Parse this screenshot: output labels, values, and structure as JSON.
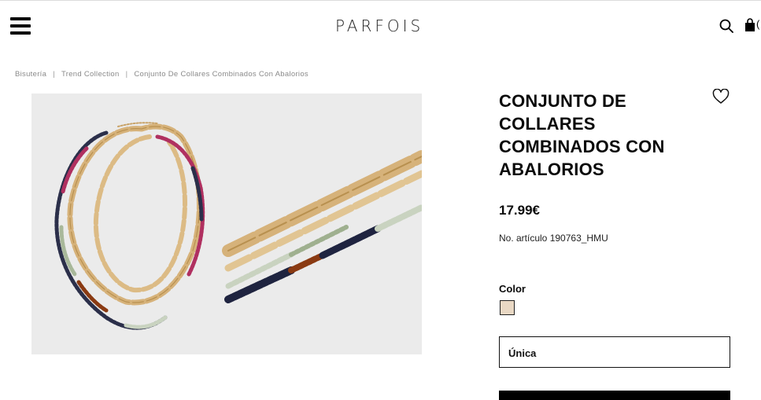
{
  "header": {
    "logo": "PARFOIS",
    "bag_count": "("
  },
  "breadcrumb": {
    "items": [
      "Bisutería",
      "Trend Collection",
      "Conjunto De Collares Combinados Con Abalorios"
    ],
    "separator": "|"
  },
  "product": {
    "title": "CONJUNTO DE COLLARES COMBINADOS CON ABALORIOS",
    "price": "17.99€",
    "sku": "No. artículo 190763_HMU",
    "color_label": "Color",
    "selected_color": "#e9d8c4",
    "size_value": "Única"
  },
  "icons": {
    "menu": "hamburger-menu-icon",
    "search": "search-icon",
    "bag": "shopping-bag-icon",
    "wishlist": "heart-icon"
  }
}
